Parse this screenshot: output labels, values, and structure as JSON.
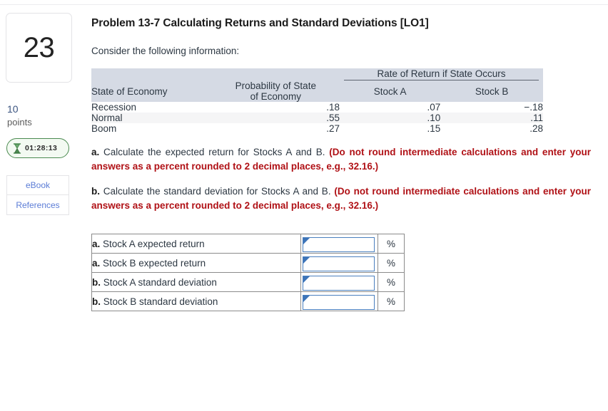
{
  "question": {
    "number": "23",
    "points_value": "10",
    "points_label": "points",
    "timer": "01:28:13",
    "timer_icon": "hourglass-icon"
  },
  "rail_links": [
    {
      "label": "eBook"
    },
    {
      "label": "References"
    }
  ],
  "main": {
    "title": "Problem 13-7 Calculating Returns and Standard Deviations [LO1]",
    "intro": "Consider the following information:"
  },
  "info_table": {
    "group_header": "Rate of Return if State Occurs",
    "headers": {
      "state": "State of Economy",
      "probability_line1": "Probability of State",
      "probability_line2": "of Economy",
      "stock_a": "Stock A",
      "stock_b": "Stock B"
    },
    "rows": [
      {
        "state": "Recession",
        "probability": ".18",
        "stock_a": ".07",
        "stock_b": "−.18"
      },
      {
        "state": "Normal",
        "probability": ".55",
        "stock_a": ".10",
        "stock_b": ".11"
      },
      {
        "state": "Boom",
        "probability": ".27",
        "stock_a": ".15",
        "stock_b": ".28"
      }
    ]
  },
  "parts": [
    {
      "letter": "a.",
      "text": "Calculate the expected return for Stocks A and B. ",
      "instruction": "(Do not round intermediate calculations and enter your answers as a percent rounded to 2 decimal places, e.g., 32.16.)"
    },
    {
      "letter": "b.",
      "text": "Calculate the standard deviation for Stocks A and B. ",
      "instruction": "(Do not round intermediate calculations and enter your answers as a percent rounded to 2 decimal places, e.g., 32.16.)"
    }
  ],
  "answer_table": {
    "percent_symbol": "%",
    "rows": [
      {
        "letter": "a.",
        "label": "Stock A expected return",
        "value": "",
        "unit": "%"
      },
      {
        "letter": "a.",
        "label": "Stock B expected return",
        "value": "",
        "unit": "%"
      },
      {
        "letter": "b.",
        "label": "Stock A standard deviation",
        "value": "",
        "unit": "%"
      },
      {
        "letter": "b.",
        "label": "Stock B standard deviation",
        "value": "",
        "unit": "%"
      }
    ]
  },
  "colors": {
    "table_header_bg": "#d5dae4",
    "stripe_bg": "#f5f5f6",
    "instruction_red": "#b01116",
    "link_blue": "#5b7cd6",
    "timer_green": "#4b8b50",
    "input_border_blue": "#4a7fbe"
  }
}
